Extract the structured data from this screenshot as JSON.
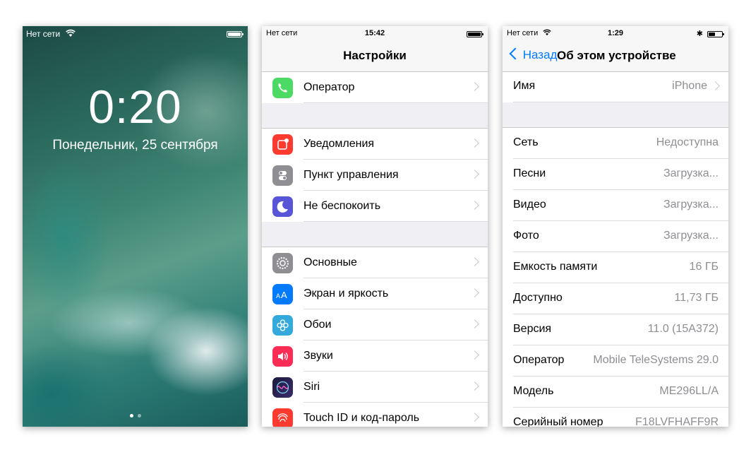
{
  "lock_screen": {
    "carrier": "Нет сети",
    "time": "0:20",
    "date": "Понедельник, 25 сентября",
    "page_dots": 2,
    "active_dot": 0
  },
  "settings_screen": {
    "status": {
      "carrier": "Нет сети",
      "time": "15:42"
    },
    "title": "Настройки",
    "groups": [
      [
        {
          "label": "Оператор",
          "icon": "phone-icon",
          "color": "#4cd964"
        }
      ],
      [
        {
          "label": "Уведомления",
          "icon": "notifications-icon",
          "color": "#ff3b30"
        },
        {
          "label": "Пункт управления",
          "icon": "control-center-icon",
          "color": "#8e8e93"
        },
        {
          "label": "Не беспокоить",
          "icon": "moon-icon",
          "color": "#5856d6"
        }
      ],
      [
        {
          "label": "Основные",
          "icon": "gear-icon",
          "color": "#8e8e93"
        },
        {
          "label": "Экран и яркость",
          "icon": "display-icon",
          "color": "#007aff"
        },
        {
          "label": "Обои",
          "icon": "wallpaper-icon",
          "color": "#34aadc"
        },
        {
          "label": "Звуки",
          "icon": "sounds-icon",
          "color": "#ff2d55"
        },
        {
          "label": "Siri",
          "icon": "siri-icon",
          "color": "#1b1b3a"
        },
        {
          "label": "Touch ID и код-пароль",
          "icon": "fingerprint-icon",
          "color": "#ff3b30"
        }
      ]
    ]
  },
  "about_screen": {
    "status": {
      "carrier": "Нет сети",
      "time": "1:29"
    },
    "back_label": "Назад",
    "title": "Об этом устройстве",
    "name_row": {
      "label": "Имя",
      "value": "iPhone"
    },
    "rows": [
      {
        "label": "Сеть",
        "value": "Недоступна"
      },
      {
        "label": "Песни",
        "value": "Загрузка..."
      },
      {
        "label": "Видео",
        "value": "Загрузка..."
      },
      {
        "label": "Фото",
        "value": "Загрузка..."
      },
      {
        "label": "Емкость памяти",
        "value": "16 ГБ"
      },
      {
        "label": "Доступно",
        "value": "11,73 ГБ"
      },
      {
        "label": "Версия",
        "value": "11.0 (15A372)"
      },
      {
        "label": "Оператор",
        "value": "Mobile TeleSystems 29.0"
      },
      {
        "label": "Модель",
        "value": "ME296LL/A"
      },
      {
        "label": "Серийный номер",
        "value": "F18LVFHAFF9R"
      }
    ]
  }
}
